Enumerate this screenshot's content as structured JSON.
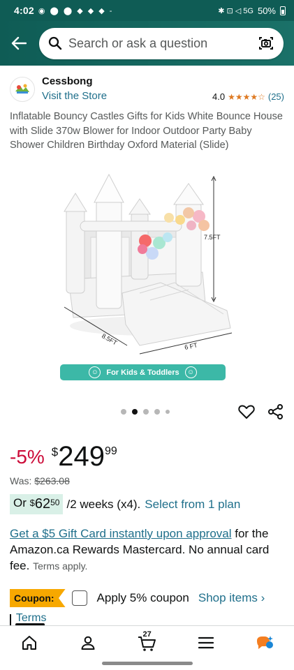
{
  "status_bar": {
    "time": "4:02",
    "left_icons": "◉ ⬤ ⬤ ◆ ◆ ◆ -",
    "right_icons": "✱ ⊡ ◁ 5G",
    "battery": "50%"
  },
  "search": {
    "placeholder": "Search or ask a question"
  },
  "store": {
    "name": "Cessbong",
    "visit_label": "Visit the Store",
    "rating_value": "4.0",
    "stars": "★★★★☆",
    "rating_count": "(25)"
  },
  "product": {
    "title": "Inflatable Bouncy Castles Gifts for Kids White Bounce House with Slide 370w Blower for Indoor Outdoor Party Baby Shower Children Birthday Oxford Material (Slide)",
    "dimension_height": "7.5FT",
    "dimension_length": "8.5FT",
    "dimension_width": "6 FT",
    "banner_text": "For Kids & Toddlers"
  },
  "price": {
    "discount": "-5%",
    "currency": "$",
    "whole": "249",
    "fraction": "99",
    "was_label": "Was:",
    "was_price": "$263.08"
  },
  "plan": {
    "or_label": "Or",
    "currency": "$",
    "whole": "62",
    "fraction": "50",
    "term": "/2 weeks (x4).",
    "link": "Select from 1 plan"
  },
  "gift": {
    "link": "Get a $5 Gift Card instantly upon approval",
    "text": " for the Amazon.ca Rewards Mastercard. No annual card fee.",
    "terms": "Terms apply."
  },
  "coupon": {
    "badge": "Coupon:",
    "text": "Apply 5% coupon",
    "shop_link": "Shop items ›",
    "terms": "Terms"
  },
  "nav": {
    "cart_count": "27"
  },
  "colors": {
    "header_bg": "#0f5c55",
    "link": "#1f6f8b",
    "discount": "#cc0c39",
    "coupon": "#f7a800",
    "banner": "#3cb8a7"
  }
}
